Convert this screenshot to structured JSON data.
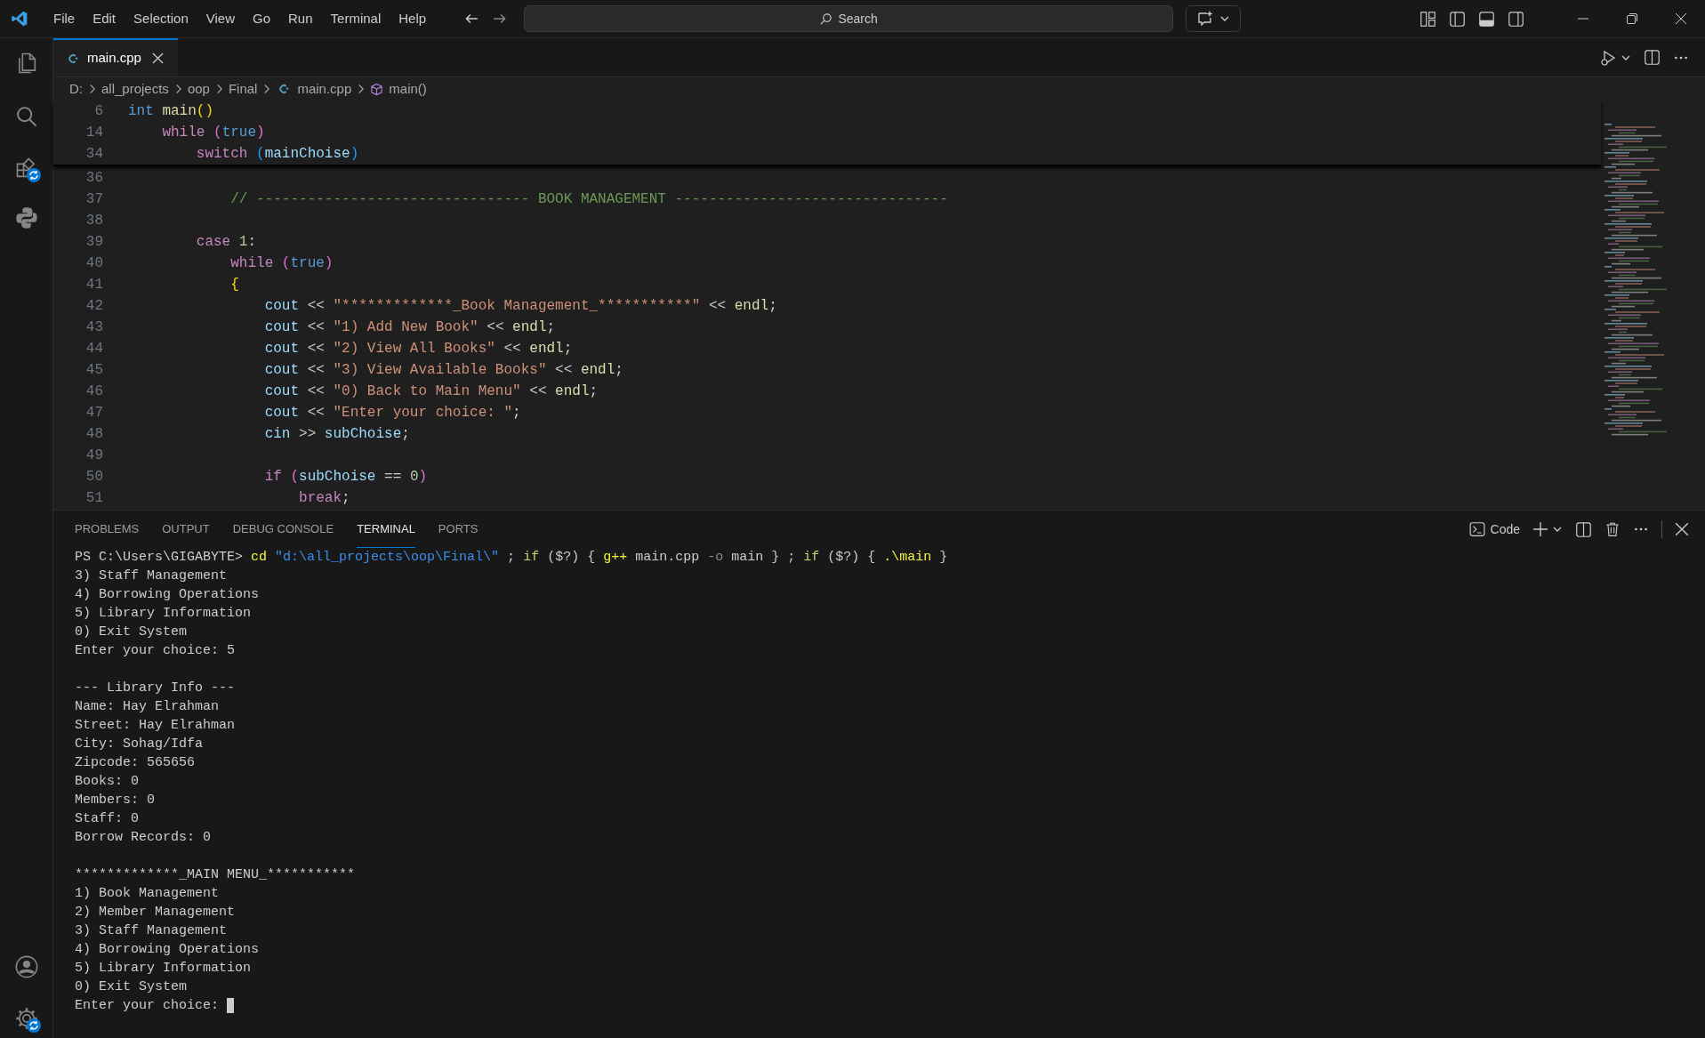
{
  "menu": [
    "File",
    "Edit",
    "Selection",
    "View",
    "Go",
    "Run",
    "Terminal",
    "Help"
  ],
  "search": {
    "placeholder": "Search"
  },
  "editor_tabs": [
    {
      "label": "main.cpp",
      "selected": true
    }
  ],
  "breadcrumb": [
    "D:",
    "all_projects",
    "oop",
    "Final",
    "main.cpp",
    "main()"
  ],
  "sticky_lines": [
    {
      "number": "6",
      "tokens": [
        {
          "text": "int ",
          "kind": "keyword"
        },
        {
          "text": "main",
          "kind": "function"
        },
        {
          "text": "()",
          "kind": "bracket_gold"
        }
      ]
    },
    {
      "number": "14",
      "tokens": [
        {
          "text": "    while ",
          "kind": "control"
        },
        {
          "text": "(",
          "kind": "bracket_orchid"
        },
        {
          "text": "true",
          "kind": "keyword"
        },
        {
          "text": ")",
          "kind": "bracket_orchid"
        }
      ]
    },
    {
      "number": "34",
      "tokens": [
        {
          "text": "        switch ",
          "kind": "control"
        },
        {
          "text": "(",
          "kind": "bracket_blue"
        },
        {
          "text": "mainChoise",
          "kind": "variable"
        },
        {
          "text": ")",
          "kind": "bracket_blue"
        }
      ]
    }
  ],
  "code_lines": [
    {
      "number": "36"
    },
    {
      "number": "37",
      "tokens": [
        {
          "text": "            // -------------------------------- BOOK MANAGEMENT --------------------------------",
          "kind": "comment"
        }
      ]
    },
    {
      "number": "38"
    },
    {
      "number": "39",
      "tokens": [
        {
          "text": "        case ",
          "kind": "control"
        },
        {
          "text": "1",
          "kind": "number"
        },
        {
          "text": ":",
          "kind": "plain"
        }
      ]
    },
    {
      "number": "40",
      "tokens": [
        {
          "text": "            while ",
          "kind": "control"
        },
        {
          "text": "(",
          "kind": "bracket_orchid"
        },
        {
          "text": "true",
          "kind": "keyword"
        },
        {
          "text": ")",
          "kind": "bracket_orchid"
        }
      ]
    },
    {
      "number": "41",
      "tokens": [
        {
          "text": "            {",
          "kind": "bracket_gold"
        }
      ]
    },
    {
      "number": "42",
      "tokens": [
        {
          "text": "                cout",
          "kind": "variable"
        },
        {
          "text": " << ",
          "kind": "plain"
        },
        {
          "text": "\"*************_Book Management_***********\"",
          "kind": "string"
        },
        {
          "text": " << ",
          "kind": "plain"
        },
        {
          "text": "endl",
          "kind": "function"
        },
        {
          "text": ";",
          "kind": "plain"
        }
      ]
    },
    {
      "number": "43",
      "tokens": [
        {
          "text": "                cout",
          "kind": "variable"
        },
        {
          "text": " << ",
          "kind": "plain"
        },
        {
          "text": "\"1) Add New Book\"",
          "kind": "string"
        },
        {
          "text": " << ",
          "kind": "plain"
        },
        {
          "text": "endl",
          "kind": "function"
        },
        {
          "text": ";",
          "kind": "plain"
        }
      ]
    },
    {
      "number": "44",
      "tokens": [
        {
          "text": "                cout",
          "kind": "variable"
        },
        {
          "text": " << ",
          "kind": "plain"
        },
        {
          "text": "\"2) View All Books\"",
          "kind": "string"
        },
        {
          "text": " << ",
          "kind": "plain"
        },
        {
          "text": "endl",
          "kind": "function"
        },
        {
          "text": ";",
          "kind": "plain"
        }
      ]
    },
    {
      "number": "45",
      "tokens": [
        {
          "text": "                cout",
          "kind": "variable"
        },
        {
          "text": " << ",
          "kind": "plain"
        },
        {
          "text": "\"3) View Available Books\"",
          "kind": "string"
        },
        {
          "text": " << ",
          "kind": "plain"
        },
        {
          "text": "endl",
          "kind": "function"
        },
        {
          "text": ";",
          "kind": "plain"
        }
      ]
    },
    {
      "number": "46",
      "tokens": [
        {
          "text": "                cout",
          "kind": "variable"
        },
        {
          "text": " << ",
          "kind": "plain"
        },
        {
          "text": "\"0) Back to Main Menu\"",
          "kind": "string"
        },
        {
          "text": " << ",
          "kind": "plain"
        },
        {
          "text": "endl",
          "kind": "function"
        },
        {
          "text": ";",
          "kind": "plain"
        }
      ]
    },
    {
      "number": "47",
      "tokens": [
        {
          "text": "                cout",
          "kind": "variable"
        },
        {
          "text": " << ",
          "kind": "plain"
        },
        {
          "text": "\"Enter your choice: \"",
          "kind": "string"
        },
        {
          "text": ";",
          "kind": "plain"
        }
      ]
    },
    {
      "number": "48",
      "tokens": [
        {
          "text": "                cin",
          "kind": "variable"
        },
        {
          "text": " >> ",
          "kind": "plain"
        },
        {
          "text": "subChoise",
          "kind": "variable"
        },
        {
          "text": ";",
          "kind": "plain"
        }
      ]
    },
    {
      "number": "49"
    },
    {
      "number": "50",
      "tokens": [
        {
          "text": "                if ",
          "kind": "control"
        },
        {
          "text": "(",
          "kind": "bracket_orchid"
        },
        {
          "text": "subChoise",
          "kind": "variable"
        },
        {
          "text": " == ",
          "kind": "plain"
        },
        {
          "text": "0",
          "kind": "number"
        },
        {
          "text": ")",
          "kind": "bracket_orchid"
        }
      ]
    },
    {
      "number": "51",
      "tokens": [
        {
          "text": "                    break",
          "kind": "control"
        },
        {
          "text": ";",
          "kind": "plain"
        }
      ]
    }
  ],
  "panel_tabs": [
    {
      "label": "PROBLEMS",
      "selected": false
    },
    {
      "label": "OUTPUT",
      "selected": false
    },
    {
      "label": "DEBUG CONSOLE",
      "selected": false
    },
    {
      "label": "TERMINAL",
      "selected": true
    },
    {
      "label": "PORTS",
      "selected": false
    }
  ],
  "terminal_profile": "Code",
  "terminal_prompt": [
    {
      "text": "PS C:\\Users\\GIGABYTE> ",
      "kind": "plain"
    },
    {
      "text": "cd ",
      "kind": "command"
    },
    {
      "text": "\"d:\\all_projects\\oop\\Final\\\"",
      "kind": "string"
    },
    {
      "text": " ; ",
      "kind": "plain"
    },
    {
      "text": "if",
      "kind": "keyword"
    },
    {
      "text": " ($?) { ",
      "kind": "plain"
    },
    {
      "text": "g++",
      "kind": "command"
    },
    {
      "text": " main.cpp ",
      "kind": "plain"
    },
    {
      "text": "-o",
      "kind": "parameter"
    },
    {
      "text": " main } ; ",
      "kind": "plain"
    },
    {
      "text": "if",
      "kind": "keyword"
    },
    {
      "text": " ($?) { ",
      "kind": "plain"
    },
    {
      "text": ".\\main",
      "kind": "command"
    },
    {
      "text": " }",
      "kind": "plain"
    }
  ],
  "terminal_output": [
    [
      "3) Staff Management",
      "4) Borrowing Operations",
      "5) Library Information",
      "0) Exit System",
      "Enter your choice: 5"
    ],
    [
      "--- Library Info ---",
      "Name: Hay Elrahman",
      "Street: Hay Elrahman",
      "City: Sohag/Idfa",
      "Zipcode: 565656",
      "Books: 0",
      "Members: 0",
      "Staff: 0",
      "Borrow Records: 0"
    ],
    [
      "*************_MAIN MENU_***********",
      "1) Book Management",
      "2) Member Management",
      "3) Staff Management",
      "4) Borrowing Operations",
      "5) Library Information",
      "0) Exit System"
    ]
  ],
  "terminal_input_prompt": "Enter your choice: "
}
